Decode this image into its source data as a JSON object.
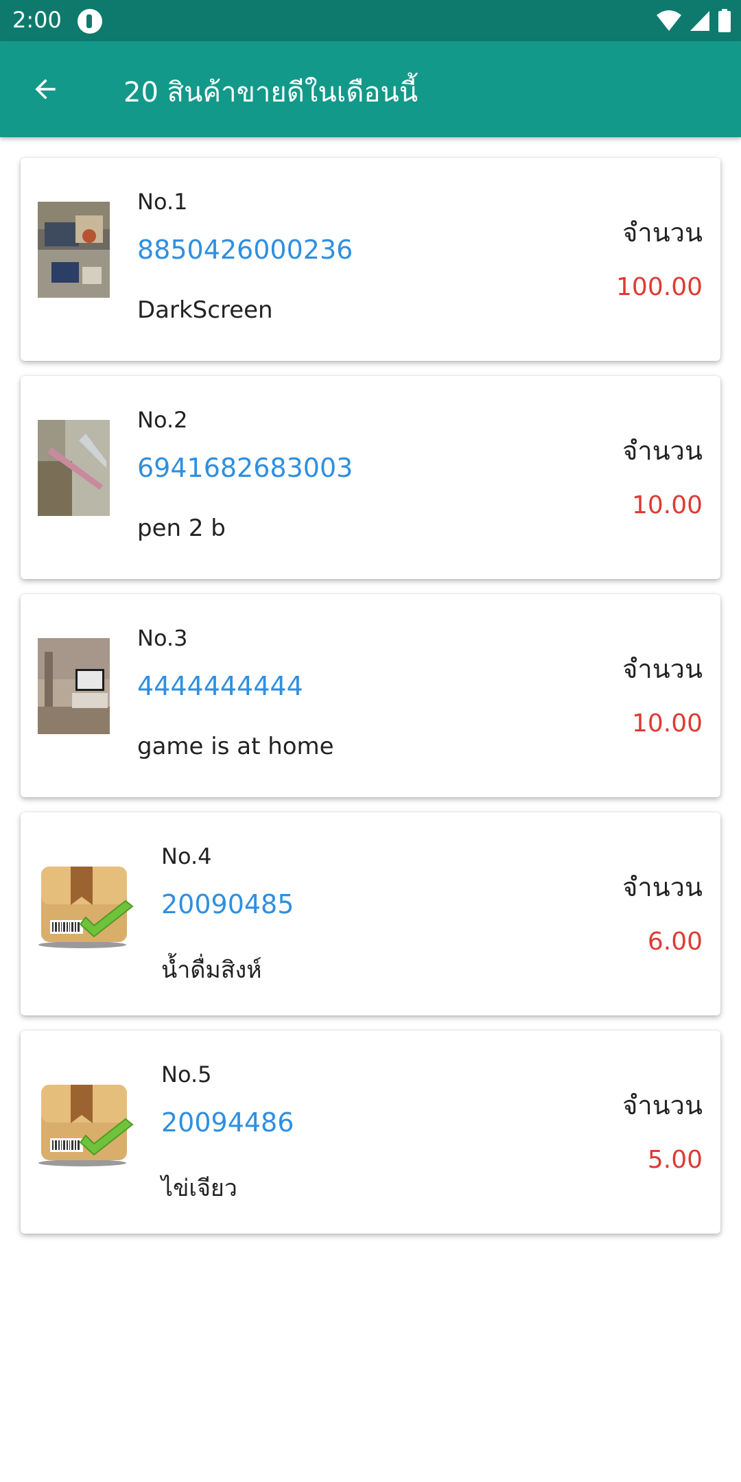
{
  "status_bar": {
    "time": "2:00"
  },
  "app_bar": {
    "title": "20 สินค้าขายดีในเดือนนี้"
  },
  "items": [
    {
      "rank": "No.1",
      "barcode": "8850426000236",
      "name": "DarkScreen",
      "qty_label": "จำนวน",
      "qty": "100.00",
      "thumbnail": "photo"
    },
    {
      "rank": "No.2",
      "barcode": "6941682683003",
      "name": "pen 2 b",
      "qty_label": "จำนวน",
      "qty": "10.00",
      "thumbnail": "photo"
    },
    {
      "rank": "No.3",
      "barcode": "4444444444",
      "name": "game is at home",
      "qty_label": "จำนวน",
      "qty": "10.00",
      "thumbnail": "photo"
    },
    {
      "rank": "No.4",
      "barcode": "20090485",
      "name": "น้ำดื่มสิงห์",
      "qty_label": "จำนวน",
      "qty": "6.00",
      "thumbnail": "package-check-icon"
    },
    {
      "rank": "No.5",
      "barcode": "20094486",
      "name": "ไข่เจียว",
      "qty_label": "จำนวน",
      "qty": "5.00",
      "thumbnail": "package-check-icon"
    }
  ],
  "colors": {
    "status_bar": "#0e7a6e",
    "app_bar": "#13998a",
    "barcode": "#2f8fe0",
    "quantity": "#dd3b33"
  }
}
